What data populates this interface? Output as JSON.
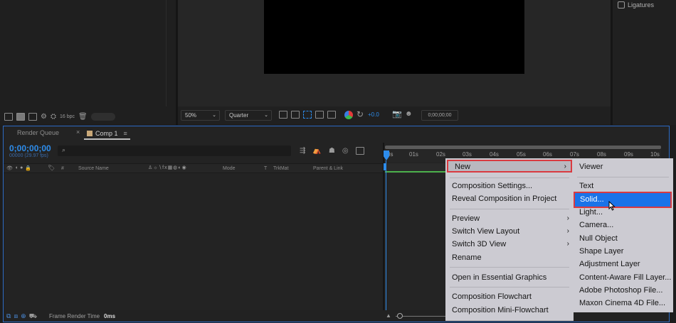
{
  "top": {
    "ligatures_label": "Ligatures",
    "bpc_label": "16 bpc",
    "zoom_value": "50%",
    "resolution_value": "Quarter",
    "exposure_value": "+0.0",
    "viewer_timecode": "0;00;00;00"
  },
  "tabs": {
    "render_queue": "Render Queue",
    "comp1": "Comp 1"
  },
  "timeline": {
    "timecode": "0;00;00;00",
    "fps": "00000 (29.97 fps)",
    "search_icon": "search-icon",
    "columns": {
      "source_name": "Source Name",
      "mode": "Mode",
      "t": "T",
      "trkmat": "TrkMat",
      "parent_link": "Parent & Link",
      "hash": "#"
    },
    "ticks": [
      "0s",
      "01s",
      "02s",
      "03s",
      "04s",
      "05s",
      "06s",
      "07s",
      "08s",
      "09s",
      "10s"
    ],
    "status_label": "Frame Render Time",
    "status_value": "0ms"
  },
  "context_menu": {
    "new": "New",
    "composition_settings": "Composition Settings...",
    "reveal_composition": "Reveal Composition in Project",
    "preview": "Preview",
    "switch_view_layout": "Switch View Layout",
    "switch_3d_view": "Switch 3D View",
    "rename": "Rename",
    "open_essential_graphics": "Open in Essential Graphics",
    "composition_flowchart": "Composition Flowchart",
    "composition_mini_flowchart": "Composition Mini-Flowchart"
  },
  "submenu": {
    "viewer": "Viewer",
    "text": "Text",
    "solid": "Solid...",
    "light": "Light...",
    "camera": "Camera...",
    "null_object": "Null Object",
    "shape_layer": "Shape Layer",
    "adjustment_layer": "Adjustment Layer",
    "content_aware_fill": "Content-Aware Fill Layer...",
    "adobe_photoshop_file": "Adobe Photoshop File...",
    "maxon_cinema4d_file": "Maxon Cinema 4D File..."
  },
  "colors": {
    "accent_blue": "#2d8ceb",
    "highlight_red": "#d93a40",
    "menu_bg": "#cccbd2",
    "selected_bg": "#1a73e8"
  }
}
